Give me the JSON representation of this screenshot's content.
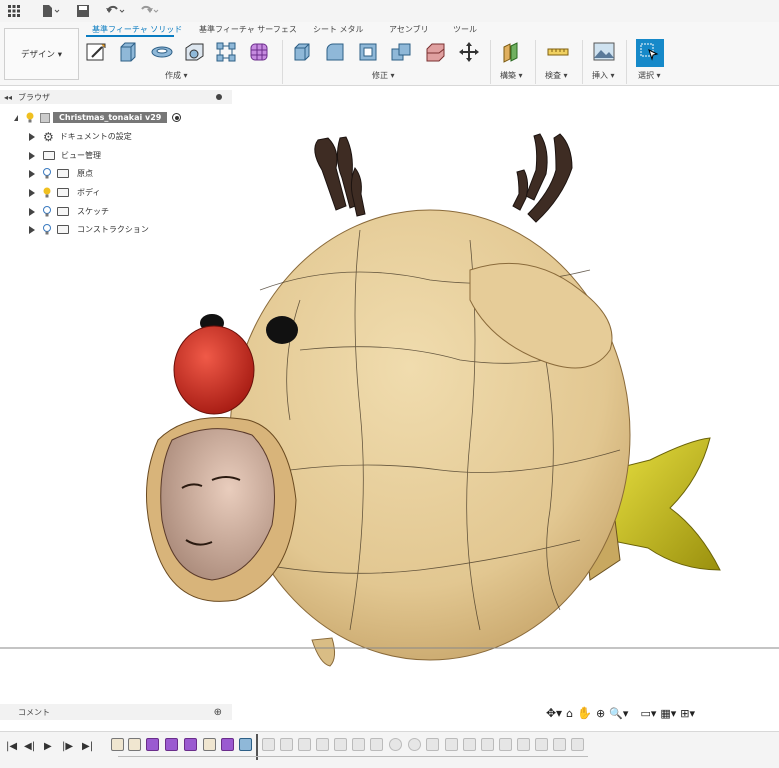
{
  "toolbar": {
    "design_label": "デザイン ▾",
    "tabs": [
      {
        "label": "基準フィーチャ ソリッド",
        "active": true
      },
      {
        "label": "基準フィーチャ サーフェス",
        "active": false
      },
      {
        "label": "シート メタル",
        "active": false
      },
      {
        "label": "アセンブリ",
        "active": false
      },
      {
        "label": "ツール",
        "active": false
      }
    ],
    "groups": {
      "create": "作成 ▾",
      "modify": "修正 ▾",
      "construct": "構築 ▾",
      "inspect": "検査 ▾",
      "insert": "挿入 ▾",
      "select": "選択 ▾"
    }
  },
  "browser": {
    "title": "ブラウザ",
    "root": "Christmas_tonakai v29",
    "items": [
      {
        "label": "ドキュメントの設定",
        "icon": "gear-icon"
      },
      {
        "label": "ビュー管理",
        "icon": "folder-icon"
      },
      {
        "label": "原点",
        "icon": "folder-icon"
      },
      {
        "label": "ボディ",
        "icon": "folder-icon"
      },
      {
        "label": "スケッチ",
        "icon": "folder-icon"
      },
      {
        "label": "コンストラクション",
        "icon": "folder-icon"
      }
    ]
  },
  "comment": {
    "label": "コメント"
  },
  "colors": {
    "accent": "#0a7cc1",
    "body": "#e2c791",
    "nose": "#c8281e",
    "antler": "#3a2a22",
    "fin": "#c8c21e"
  },
  "icons": [
    "grid-icon",
    "file-icon",
    "save-icon",
    "undo-icon",
    "redo-icon",
    "orbit-icon",
    "look-at-icon",
    "pan-icon",
    "zoom-icon",
    "display-settings-icon",
    "grid-settings-icon",
    "viewports-icon"
  ]
}
